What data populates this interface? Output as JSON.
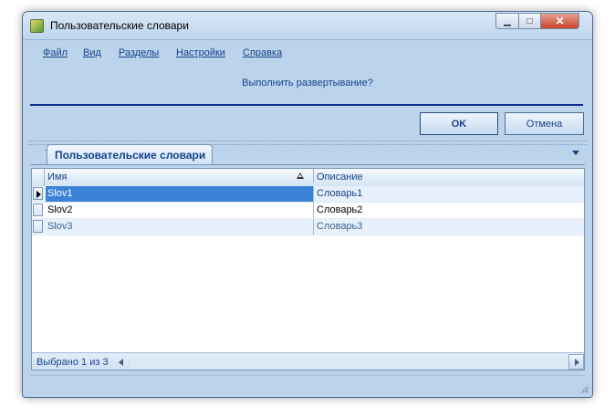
{
  "window": {
    "title": "Пользовательские словари",
    "icon": "dictionary-app-icon"
  },
  "menu": {
    "items": [
      "Файл",
      "Вид",
      "Разделы",
      "Настройки",
      "Справка"
    ]
  },
  "prompt": {
    "question": "Выполнить развертывание?",
    "ok_label": "OK",
    "cancel_label": "Отмена"
  },
  "tabs": [
    {
      "label": "Пользовательские словари",
      "active": true
    }
  ],
  "grid": {
    "columns": [
      "Имя",
      "Описание"
    ],
    "sort_column": "Имя",
    "rows": [
      {
        "name": "Slov1",
        "description": "Словарь1",
        "selected": true
      },
      {
        "name": "Slov2",
        "description": "Словарь2",
        "selected": false
      },
      {
        "name": "Slov3",
        "description": "Словарь3",
        "selected": false
      }
    ],
    "status": "Выбрано 1 из 3"
  },
  "colors": {
    "window_bg": "#bcd3ec",
    "accent_text": "#15428b",
    "selection": "#3b83d6",
    "separator": "#102f8e"
  }
}
